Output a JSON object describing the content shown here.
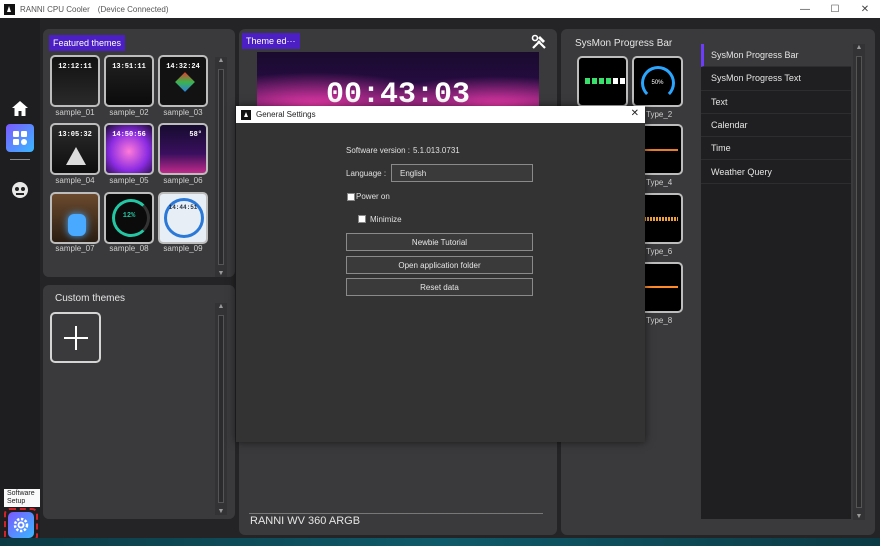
{
  "window": {
    "title": "RANNI CPU Cooler",
    "status": "(Device Connected)",
    "minimize_glyph": "—",
    "maximize_glyph": "☐",
    "close_glyph": "✕"
  },
  "rail": {
    "tooltip": "Software Setup",
    "icons": [
      "home-icon",
      "apps-icon",
      "robot-icon",
      "gear-icon"
    ]
  },
  "featured": {
    "label": "Featured themes",
    "items": [
      {
        "caption": "sample_01",
        "clock": "12:12:11"
      },
      {
        "caption": "sample_02",
        "clock": "13:51:11"
      },
      {
        "caption": "sample_03",
        "clock": "14:32:24"
      },
      {
        "caption": "sample_04",
        "clock": "13:05:32"
      },
      {
        "caption": "sample_05",
        "clock": "14:50:56"
      },
      {
        "caption": "sample_06",
        "clock": "58°"
      },
      {
        "caption": "sample_07",
        "clock": ""
      },
      {
        "caption": "sample_08",
        "clock": "12%"
      },
      {
        "caption": "sample_09",
        "clock": "14:44:51"
      }
    ]
  },
  "custom": {
    "label": "Custom themes"
  },
  "editor": {
    "label": "Theme ed···",
    "clock": "00:43:03",
    "device_name": "RANNI WV 360 ARGB"
  },
  "sysmon": {
    "header": "SysMon Progress Bar",
    "types": [
      {
        "caption": "Type_2"
      },
      {
        "caption": "Type_4"
      },
      {
        "caption": "Type_6"
      },
      {
        "caption": "Type_8"
      }
    ],
    "gauge_text": "50%",
    "list": [
      {
        "label": "SysMon Progress Bar",
        "active": true
      },
      {
        "label": "SysMon Progress Text",
        "active": false
      },
      {
        "label": "Text",
        "active": false
      },
      {
        "label": "Calendar",
        "active": false
      },
      {
        "label": "Time",
        "active": false
      },
      {
        "label": "Weather Query",
        "active": false
      }
    ]
  },
  "dialog": {
    "title": "General Settings",
    "close_glyph": "✕",
    "version_label": "Software version :",
    "version_value": "5.1.013.0731",
    "language_label": "Language :",
    "language_value": "English",
    "power_on_label": "Power on",
    "minimize_label": "Minimize",
    "buttons": [
      "Newbie Tutorial",
      "Open application folder",
      "Reset data"
    ]
  },
  "colors": {
    "accent": "#4b1fc4",
    "highlight": "#d3232a",
    "app_bg": "#242426",
    "panel_bg": "#3a3a3c"
  }
}
